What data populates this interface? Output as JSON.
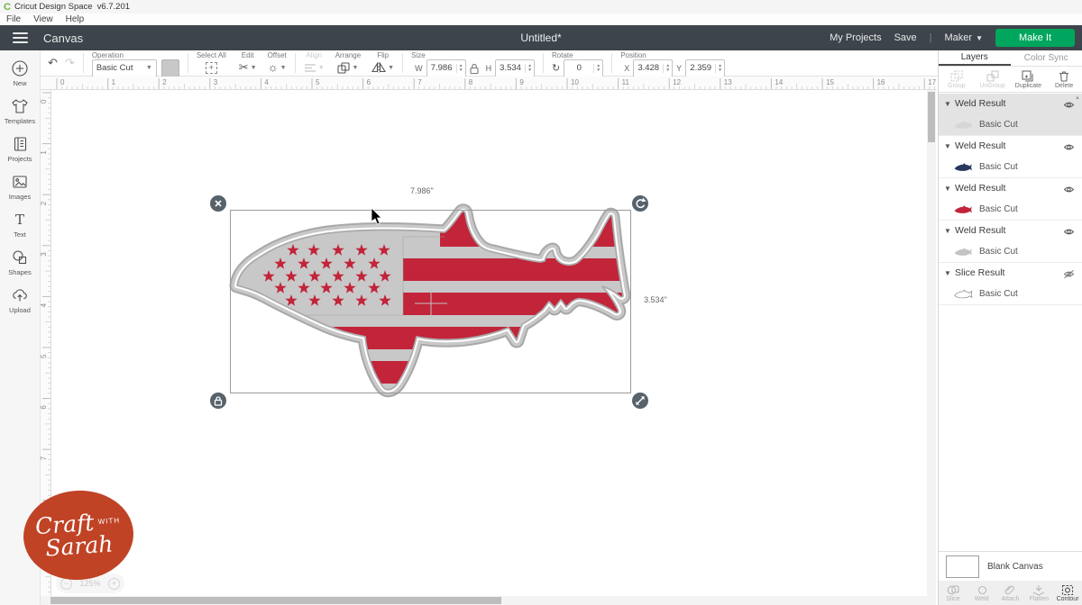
{
  "titlebar": {
    "app_name": "Cricut Design Space",
    "version": "v6.7.201",
    "menus": [
      {
        "label": "File"
      },
      {
        "label": "View"
      },
      {
        "label": "Help"
      }
    ]
  },
  "header": {
    "page_title": "Canvas",
    "document_title": "Untitled*",
    "my_projects": "My Projects",
    "save": "Save",
    "machine": "Maker",
    "make_it": "Make It"
  },
  "toolbar": {
    "operation_label": "Operation",
    "operation_value": "Basic Cut",
    "select_all": "Select All",
    "edit": "Edit",
    "offset": "Offset",
    "align": "Align",
    "arrange": "Arrange",
    "flip": "Flip",
    "size_label": "Size",
    "w_label": "W",
    "size_w": "7.986",
    "h_label": "H",
    "size_h": "3.534",
    "rotate_label": "Rotate",
    "rotate_value": "0",
    "position_label": "Position",
    "x_label": "X",
    "pos_x": "3.428",
    "y_label": "Y",
    "pos_y": "2.359"
  },
  "sidebar": {
    "items": [
      {
        "label": "New"
      },
      {
        "label": "Templates"
      },
      {
        "label": "Projects"
      },
      {
        "label": "Images"
      },
      {
        "label": "Text"
      },
      {
        "label": "Shapes"
      },
      {
        "label": "Upload"
      }
    ]
  },
  "canvas": {
    "selection_width": "7.986\"",
    "selection_height": "3.534\"",
    "zoom_level": "125%",
    "ruler_h_inches": 18,
    "ruler_v_inches": 10
  },
  "layers_panel": {
    "tabs": [
      {
        "label": "Layers"
      },
      {
        "label": "Color Sync"
      }
    ],
    "actions": [
      {
        "label": "Group"
      },
      {
        "label": "UnGroup"
      },
      {
        "label": "Duplicate"
      },
      {
        "label": "Delete"
      }
    ],
    "groups": [
      {
        "title": "Weld Result",
        "child": "Basic Cut",
        "visibility": "visible",
        "selected": true
      },
      {
        "title": "Weld Result",
        "child": "Basic Cut",
        "visibility": "visible",
        "selected": false
      },
      {
        "title": "Weld Result",
        "child": "Basic Cut",
        "visibility": "visible",
        "selected": false
      },
      {
        "title": "Weld Result",
        "child": "Basic Cut",
        "visibility": "visible",
        "selected": false
      },
      {
        "title": "Slice Result",
        "child": "Basic Cut",
        "visibility": "hidden",
        "selected": false
      }
    ],
    "blank_canvas_label": "Blank Canvas",
    "bottom_actions": [
      {
        "label": "Slice"
      },
      {
        "label": "Weld"
      },
      {
        "label": "Attach"
      },
      {
        "label": "Flatten"
      },
      {
        "label": "Contour"
      }
    ]
  },
  "zoom_control": {
    "minus": "−",
    "plus": "+"
  },
  "logo": {
    "word1": "Craft",
    "word2": "with",
    "word3": "Sarah"
  },
  "colors": {
    "accent_green": "#00a65e",
    "cricut_green": "#6cb33f",
    "header_dark": "#3d444b",
    "flag_red": "#c2243a",
    "flag_gray": "#c8c8c8",
    "thumb_navy": "#27375e",
    "logo_red": "#c04326"
  }
}
